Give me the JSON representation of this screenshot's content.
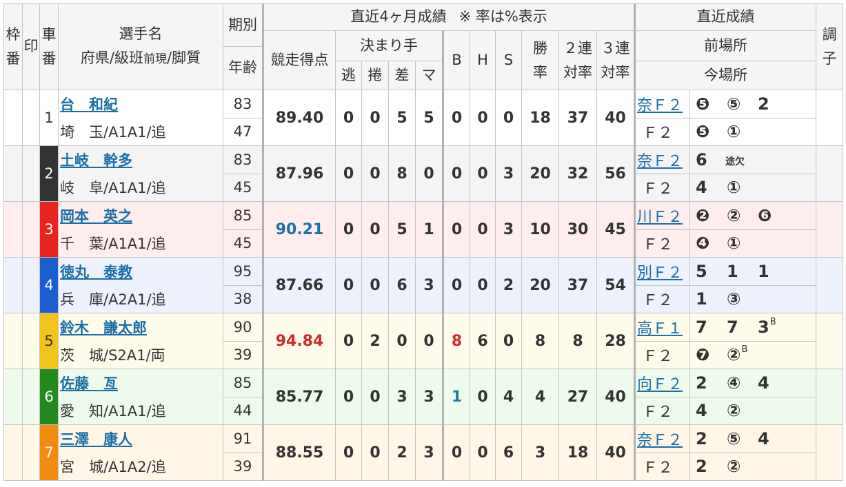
{
  "header": {
    "frame": [
      "枠",
      "番"
    ],
    "mark": "印",
    "car": [
      "車",
      "番"
    ],
    "player_name": "選手名",
    "player_sub": [
      "府県/級班",
      "前現",
      "/脚質"
    ],
    "term": "期別",
    "age": "年齢",
    "recent_4_months": "直近4ヶ月成績",
    "rate_note": "※ 率は%表示",
    "score": "競走得点",
    "kimarite": "決まり手",
    "nige": "逃",
    "makuri": "捲",
    "sashi": "差",
    "mark_k": "マ",
    "b": "B",
    "h": "H",
    "s": "S",
    "win_rate": [
      "勝",
      "率"
    ],
    "top2_rate": [
      "２連",
      "対率"
    ],
    "top3_rate": [
      "３連",
      "対率"
    ],
    "recent_results": "直近成績",
    "prev_meet": "前場所",
    "curr_meet": "今場所",
    "condition": [
      "調",
      "子"
    ]
  },
  "riders": [
    {
      "car": "1",
      "frame_color": "#ffffff",
      "car_text_color": "#333333",
      "row_bg": "#ffffff",
      "name": "台　和紀",
      "region": "埼　玉/A1A1/追",
      "term": "83",
      "age": "47",
      "score": "89.40",
      "nige": "0",
      "makuri": "0",
      "sashi": "5",
      "mark": "5",
      "b": "0",
      "h": "0",
      "s": "0",
      "win": "18",
      "top2": "37",
      "top3": "40",
      "prev": {
        "venue": "奈Ｆ２",
        "results": [
          {
            "v": "❺"
          },
          {
            "v": "⑤"
          },
          {
            "v": "2"
          }
        ]
      },
      "curr": {
        "venue": "Ｆ２",
        "results": [
          {
            "v": "❺"
          },
          {
            "v": "①"
          }
        ]
      }
    },
    {
      "car": "2",
      "frame_color": "#333333",
      "car_text_color": "#ffffff",
      "row_bg": "#f4f4f4",
      "name": "土岐　幹多",
      "region": "岐　阜/A1A1/追",
      "term": "83",
      "age": "45",
      "score": "87.96",
      "nige": "0",
      "makuri": "0",
      "sashi": "8",
      "mark": "0",
      "b": "0",
      "h": "0",
      "s": "3",
      "win": "20",
      "top2": "32",
      "top3": "56",
      "prev": {
        "venue": "奈Ｆ２",
        "results": [
          {
            "v": "6"
          },
          {
            "v": "途欠",
            "small": true
          }
        ]
      },
      "curr": {
        "venue": "Ｆ２",
        "results": [
          {
            "v": "4"
          },
          {
            "v": "①"
          }
        ]
      }
    },
    {
      "car": "3",
      "frame_color": "#e8241f",
      "car_text_color": "#ffffff",
      "row_bg": "#fdeded",
      "name": "岡本　英之",
      "region": "千　葉/A1A1/追",
      "term": "85",
      "age": "45",
      "score": "90.21",
      "score_color": "#1f6fa6",
      "nige": "0",
      "makuri": "0",
      "sashi": "5",
      "mark": "1",
      "b": "0",
      "h": "0",
      "s": "3",
      "win": "10",
      "top2": "30",
      "top3": "45",
      "prev": {
        "venue": "川Ｆ２",
        "results": [
          {
            "v": "❷"
          },
          {
            "v": "②"
          },
          {
            "v": "❻"
          }
        ]
      },
      "curr": {
        "venue": "Ｆ２",
        "results": [
          {
            "v": "❹"
          },
          {
            "v": "①"
          }
        ]
      }
    },
    {
      "car": "4",
      "frame_color": "#1a5fcf",
      "car_text_color": "#ffffff",
      "row_bg": "#edf1fb",
      "name": "徳丸　泰教",
      "region": "兵　庫/A2A1/追",
      "term": "95",
      "age": "38",
      "score": "87.66",
      "nige": "0",
      "makuri": "0",
      "sashi": "6",
      "mark": "3",
      "b": "0",
      "h": "0",
      "s": "2",
      "win": "20",
      "top2": "37",
      "top3": "54",
      "prev": {
        "venue": "別Ｆ２",
        "results": [
          {
            "v": "5"
          },
          {
            "v": "1"
          },
          {
            "v": "1"
          }
        ]
      },
      "curr": {
        "venue": "Ｆ２",
        "results": [
          {
            "v": "1"
          },
          {
            "v": "③"
          }
        ]
      }
    },
    {
      "car": "5",
      "frame_color": "#f2c419",
      "car_text_color": "#333333",
      "row_bg": "#fdfbea",
      "name": "鈴木　謙太郎",
      "region": "茨　城/S2A1/両",
      "term": "90",
      "age": "39",
      "score": "94.84",
      "score_color": "#d12a2a",
      "nige": "0",
      "makuri": "2",
      "sashi": "0",
      "mark": "0",
      "b": "8",
      "h": "6",
      "s": "0",
      "colors": {
        "b": "#d12a2a"
      },
      "win": "8",
      "top2": "8",
      "top3": "28",
      "prev": {
        "venue": "高Ｆ１",
        "results": [
          {
            "v": "7"
          },
          {
            "v": "7"
          },
          {
            "v": "3",
            "sup": "B"
          }
        ]
      },
      "curr": {
        "venue": "Ｆ２",
        "results": [
          {
            "v": "❼"
          },
          {
            "v": "②",
            "sup": "B"
          }
        ]
      }
    },
    {
      "car": "6",
      "frame_color": "#238a1f",
      "car_text_color": "#ffffff",
      "row_bg": "#eefaec",
      "name": "佐藤　亙",
      "region": "愛　知/A1A1/追",
      "term": "85",
      "age": "44",
      "score": "85.77",
      "nige": "0",
      "makuri": "0",
      "sashi": "3",
      "mark": "3",
      "b": "1",
      "h": "0",
      "s": "4",
      "colors": {
        "b": "#1f7fa8"
      },
      "win": "4",
      "top2": "27",
      "top3": "40",
      "prev": {
        "venue": "向Ｆ２",
        "results": [
          {
            "v": "2"
          },
          {
            "v": "④"
          },
          {
            "v": "4"
          }
        ]
      },
      "curr": {
        "venue": "Ｆ２",
        "results": [
          {
            "v": "4"
          },
          {
            "v": "②"
          }
        ]
      }
    },
    {
      "car": "7",
      "frame_color": "#f48a12",
      "car_text_color": "#ffffff",
      "row_bg": "#fff6e8",
      "name": "三澤　康人",
      "region": "宮　城/A1A2/追",
      "term": "91",
      "age": "39",
      "score": "88.55",
      "nige": "0",
      "makuri": "0",
      "sashi": "2",
      "mark": "3",
      "b": "0",
      "h": "0",
      "s": "6",
      "win": "3",
      "top2": "18",
      "top3": "40",
      "prev": {
        "venue": "奈Ｆ２",
        "results": [
          {
            "v": "2"
          },
          {
            "v": "⑤"
          },
          {
            "v": "4"
          }
        ]
      },
      "curr": {
        "venue": "Ｆ２",
        "results": [
          {
            "v": "2"
          },
          {
            "v": "②"
          }
        ]
      }
    }
  ]
}
